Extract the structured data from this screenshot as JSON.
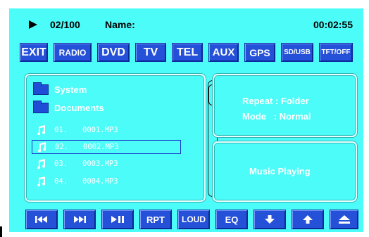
{
  "status": {
    "track_counter": "02/100",
    "name_label": "Name:",
    "time": "00:02:55"
  },
  "sources": [
    {
      "label": "EXIT",
      "name": "exit-button"
    },
    {
      "label": "RADIO",
      "name": "radio-button"
    },
    {
      "label": "DVD",
      "name": "dvd-button"
    },
    {
      "label": "TV",
      "name": "tv-button"
    },
    {
      "label": "TEL",
      "name": "tel-button"
    },
    {
      "label": "AUX",
      "name": "aux-button"
    },
    {
      "label": "GPS",
      "name": "gps-button"
    },
    {
      "label": "SD/USB",
      "name": "sd-usb-button"
    },
    {
      "label": "TFT/OFF",
      "name": "tft-off-button"
    }
  ],
  "browser": {
    "folders": [
      "System",
      "Documents"
    ],
    "files": [
      {
        "num": "01.",
        "name": "0001.MP3"
      },
      {
        "num": "02.",
        "name": "0002.MP3"
      },
      {
        "num": "03.",
        "name": "0003.MP3"
      },
      {
        "num": "04.",
        "name": "0004.MP3"
      }
    ],
    "selected_index": 1
  },
  "settings": {
    "repeat_line": "Repeat : Folder",
    "mode_line": "Mode   : Normal"
  },
  "playback": {
    "status_text": "Music Playing"
  },
  "controls": [
    {
      "name": "previous-track-button",
      "icon": "previous-icon",
      "label": ""
    },
    {
      "name": "next-track-button",
      "icon": "next-icon",
      "label": ""
    },
    {
      "name": "play-pause-button",
      "icon": "play-pause-icon",
      "label": ""
    },
    {
      "name": "repeat-button",
      "icon": "",
      "label": "RPT"
    },
    {
      "name": "loud-button",
      "icon": "",
      "label": "LOUD"
    },
    {
      "name": "eq-button",
      "icon": "",
      "label": "EQ"
    },
    {
      "name": "down-button",
      "icon": "arrow-down-icon",
      "label": ""
    },
    {
      "name": "up-button",
      "icon": "arrow-up-icon",
      "label": ""
    },
    {
      "name": "eject-button",
      "icon": "eject-icon",
      "label": ""
    }
  ],
  "colors": {
    "screen_bg": "#4cfcf9",
    "button_bg": "#2451d8",
    "selection_border": "#1638c9"
  }
}
